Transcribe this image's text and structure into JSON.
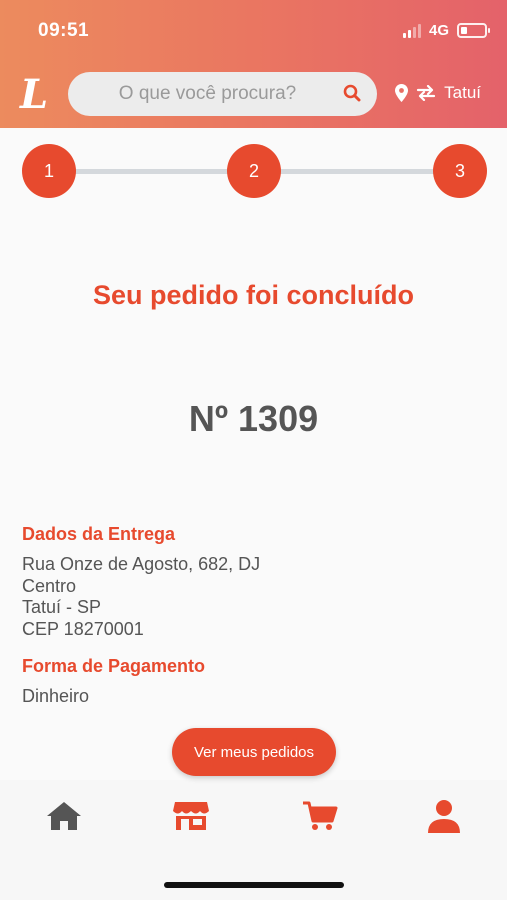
{
  "status": {
    "time": "09:51",
    "network": "4G"
  },
  "header": {
    "logo": "L",
    "search_placeholder": "O que você procura?",
    "location": "Tatuí"
  },
  "stepper": {
    "steps": [
      "1",
      "2",
      "3"
    ]
  },
  "main": {
    "title": "Seu pedido foi concluído",
    "order_number": "Nº 1309"
  },
  "delivery": {
    "heading": "Dados da Entrega",
    "address_line1": "Rua Onze de Agosto, 682, DJ",
    "address_line2": "Centro",
    "address_line3": "Tatuí - SP",
    "address_line4": "CEP 18270001"
  },
  "payment": {
    "heading": "Forma de Pagamento",
    "method": "Dinheiro"
  },
  "actions": {
    "view_orders": "Ver meus pedidos"
  },
  "tabbar": {
    "icons": [
      "home-icon",
      "store-icon",
      "cart-icon",
      "user-icon"
    ]
  },
  "colors": {
    "accent": "#e74a2e",
    "header_start": "#ec8b5e",
    "header_end": "#e4626a",
    "tab_home": "#555555"
  }
}
